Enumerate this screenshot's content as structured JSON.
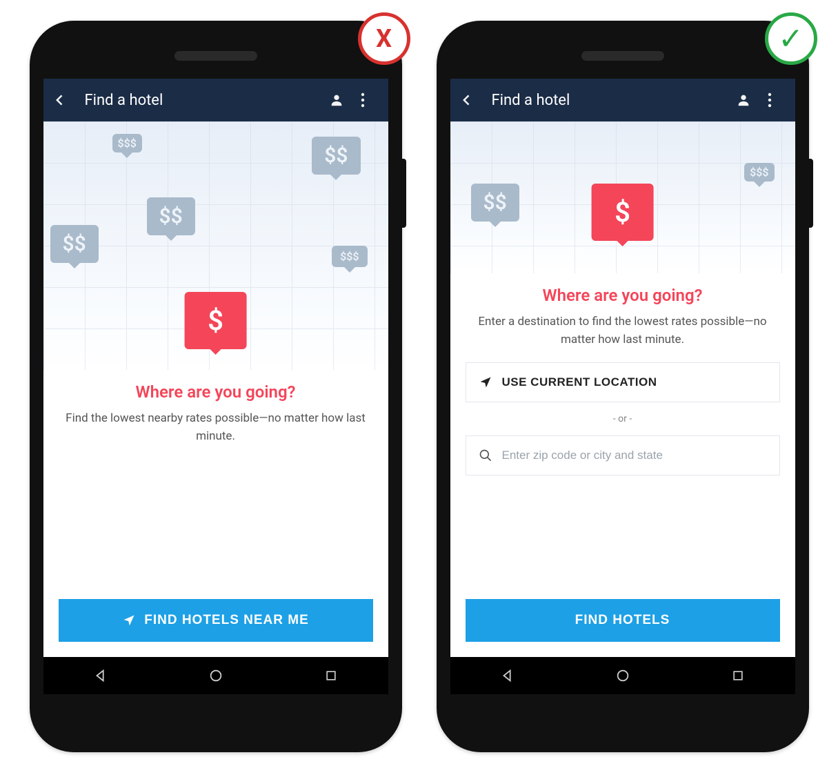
{
  "badges": {
    "wrong_symbol": "X",
    "right_symbol": "✓"
  },
  "appbar": {
    "title": "Find a hotel"
  },
  "left": {
    "heading": "Where are you going?",
    "subtext": "Find the lowest nearby rates possible—no matter how last minute.",
    "cta": "FIND HOTELS NEAR ME",
    "price_tags": [
      "$$$",
      "$$",
      "$$",
      "$$",
      "$$$",
      "$"
    ]
  },
  "right": {
    "heading": "Where are you going?",
    "subtext": "Enter a destination to find the lowest rates possible—no matter how last minute.",
    "use_location": "USE CURRENT LOCATION",
    "divider": "- or -",
    "search_placeholder": "Enter zip code or city and state",
    "cta": "FIND HOTELS",
    "price_tags": [
      "$$$",
      "$$",
      "$"
    ]
  }
}
